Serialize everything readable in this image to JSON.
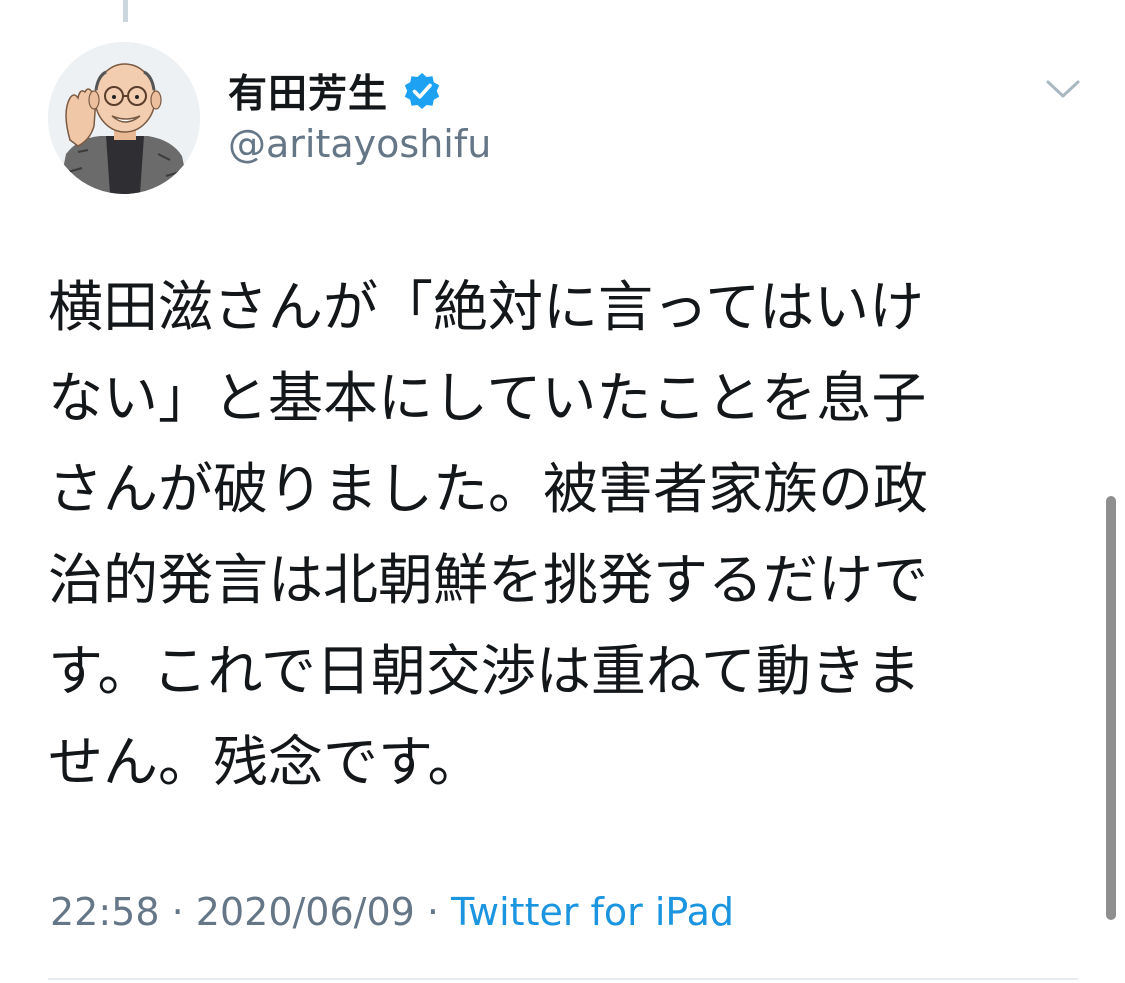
{
  "tweet": {
    "author": {
      "display_name": "有田芳生",
      "handle": "@aritayoshifu",
      "verified": true,
      "verified_icon": "verified-badge-icon",
      "avatar_icon": "caricature-avatar"
    },
    "text_lines": [
      "横田滋さんが「絶対に言ってはいけ",
      "ない」と基本にしていたことを息子",
      "さんが破りました。被害者家族の政",
      "治的発言は北朝鮮を挑発するだけで",
      "す。これで日朝交渉は重ねて動きま",
      "せん。残念です。"
    ],
    "time": "22:58",
    "separator": "·",
    "date": "2020/06/09",
    "source": "Twitter for iPad"
  },
  "colors": {
    "text": "#14171a",
    "secondary": "#657786",
    "link": "#1b95e0",
    "verified": "#1da1f2",
    "divider": "#e6ecf0"
  },
  "icons": {
    "more_menu": "chevron-down-icon"
  }
}
